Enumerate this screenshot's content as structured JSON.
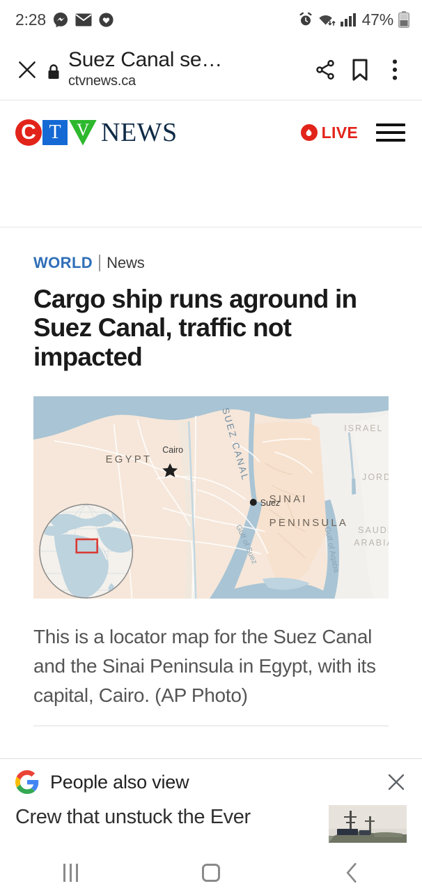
{
  "status_bar": {
    "time": "2:28",
    "battery_percent": "47%",
    "icons": [
      "messenger-icon",
      "email-icon",
      "heart-circle-icon",
      "alarm-icon",
      "wifi-icon",
      "signal-icon",
      "battery-icon"
    ]
  },
  "browser": {
    "close_label": "close-tab",
    "page_title": "Suez Canal se…",
    "url": "ctvnews.ca",
    "share_label": "share",
    "bookmark_label": "bookmark",
    "menu_label": "more-options"
  },
  "site_header": {
    "logo_c": "C",
    "logo_t": "T",
    "logo_v": "V",
    "logo_word": "NEWS",
    "live_label": "LIVE",
    "menu_label": "menu",
    "brand_red": "#e2231a",
    "brand_blue": "#1569d4",
    "brand_green": "#2eb82e",
    "brand_navy": "#0f2b46"
  },
  "article": {
    "kicker_primary": "WORLD",
    "kicker_secondary": "News",
    "kicker_color": "#2f6fb8",
    "headline": "Cargo ship runs aground in Suez Canal, traffic not impacted",
    "caption": "This is a locator map for the Suez Canal and the Sinai Peninsula in Egypt, with its capital, Cairo. (AP Photo)"
  },
  "map": {
    "alt": "locator map of Suez Canal and Sinai Peninsula",
    "labels": {
      "egypt": "EGYPT",
      "cairo": "Cairo",
      "suez_canal": "SUEZ CANAL",
      "suez": "Suez",
      "sinai": "SINAI",
      "peninsula": "PENINSULA",
      "israel": "ISRAEL",
      "jordan": "JORDAN",
      "saudi_arabia_1": "SAUDI",
      "saudi_arabia_2": "ARABIA",
      "gulf_of_suez": "Gulf of Suez",
      "gulf_of_aqaba": "Gulf of Aqaba"
    },
    "colors": {
      "land": "#f4e3d6",
      "desert": "#f7eadd",
      "water": "#a9c4d4",
      "neighbor_land": "#f3f1ee",
      "label_dark": "#6b6257",
      "label_light": "#b6b0a8",
      "water_label": "#7d98ab",
      "highlight_box": "#d93a33"
    }
  },
  "people_also_view": {
    "title": "People also view",
    "logo": "google-g-icon",
    "close_label": "dismiss",
    "items": [
      {
        "text": "Crew that unstuck the Ever",
        "thumb": "ship-photo-thumbnail"
      }
    ]
  },
  "nav_bar": {
    "recents_label": "recent-apps",
    "home_label": "home",
    "back_label": "back"
  }
}
